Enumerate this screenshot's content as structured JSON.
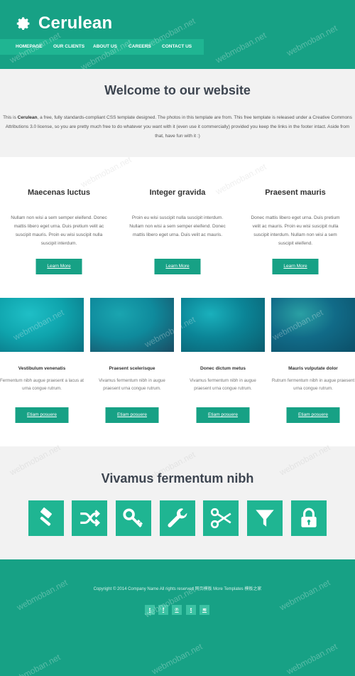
{
  "site": {
    "title": "Cerulean"
  },
  "nav": {
    "items": [
      "HOMEPAGE",
      "OUR CLIENTS",
      "ABOUT US",
      "CAREERS",
      "CONTACT US"
    ]
  },
  "welcome": {
    "heading": "Welcome to our website",
    "text_before": "This is ",
    "text_bold": "Cerulean",
    "text_after": ", a free, fully standards-compliant CSS template designed. The photos in this template are from. This free template is released under a Creative Commons Attributions 3.0 license, so you are pretty much free to do whatever you want with it (even use it commercially) provided you keep the links in the footer intact. Aside from that, have fun with it :)"
  },
  "features": [
    {
      "title": "Maecenas luctus",
      "text": "Nullam non wisi a sem semper eleifend. Donec mattis libero eget urna. Duis pretium velit ac suscipit mauris. Proin eu wisi suscipit nulla suscipit interdum.",
      "button": "Learn More"
    },
    {
      "title": "Integer gravida",
      "text": "Proin eu wisi suscipit nulla suscipit interdum. Nullam non wisi a sem semper eleifend. Donec mattis libero eget urna. Duis velit ac mauris.",
      "button": "Learn More"
    },
    {
      "title": "Praesent mauris",
      "text": "Donec mattis libero eget urna. Duis pretium velit ac mauris. Proin eu wisi suscipit nulla suscipit interdum. Nullam non wisi a sem suscipit eleifend.",
      "button": "Learn More"
    }
  ],
  "gallery": [
    {
      "title": "Vestibulum venenatis",
      "text": "Fermentum nibh augue praesent a lacus at urna congue rutrum.",
      "button": "Etiam posuere",
      "colors": [
        "#0fa4ad",
        "#1fbfc6",
        "#0a6f80"
      ]
    },
    {
      "title": "Praesent scelerisque",
      "text": "Vivamus fermentum nibh in augue praesent urna congue rutrum.",
      "button": "Etiam posuere",
      "colors": [
        "#0f8a9c",
        "#1aa5b0",
        "#1a4c63"
      ]
    },
    {
      "title": "Donec dictum metus",
      "text": "Vivamus fermentum nibh in augue praesent urna congue rutrum.",
      "button": "Etiam posuere",
      "colors": [
        "#0b8496",
        "#1ab0bc",
        "#0b5c6e"
      ]
    },
    {
      "title": "Mauris vulputate dolor",
      "text": "Rutrum fermentum nibh in augue praesent urna congue rutrum.",
      "button": "Etiam posuere",
      "colors": [
        "#116b88",
        "#2aa0a4",
        "#0b4f68"
      ]
    }
  ],
  "tools": {
    "heading": "Vivamus fermentum nibh",
    "icons": [
      "gavel-icon",
      "shuffle-icon",
      "key-icon",
      "wrench-icon",
      "scissors-icon",
      "filter-icon",
      "lock-icon"
    ]
  },
  "footer": {
    "copyright": "Copyright © 2014 Company Name All rights reserved 网页模板 More Templates 模板之家",
    "social": [
      {
        "icon": "twitter-icon",
        "glyph": "t"
      },
      {
        "icon": "facebook-icon",
        "glyph": "f"
      },
      {
        "icon": "pinterest-icon",
        "glyph": "℗"
      },
      {
        "icon": "tumblr-icon",
        "glyph": "t"
      },
      {
        "icon": "rss-icon",
        "glyph": "≋"
      }
    ]
  },
  "watermark": "webmoban.net",
  "colors": {
    "primary": "#17a185",
    "primary_light": "#1fb592",
    "light_bg": "#f2f2f2",
    "heading": "#3d4550"
  }
}
